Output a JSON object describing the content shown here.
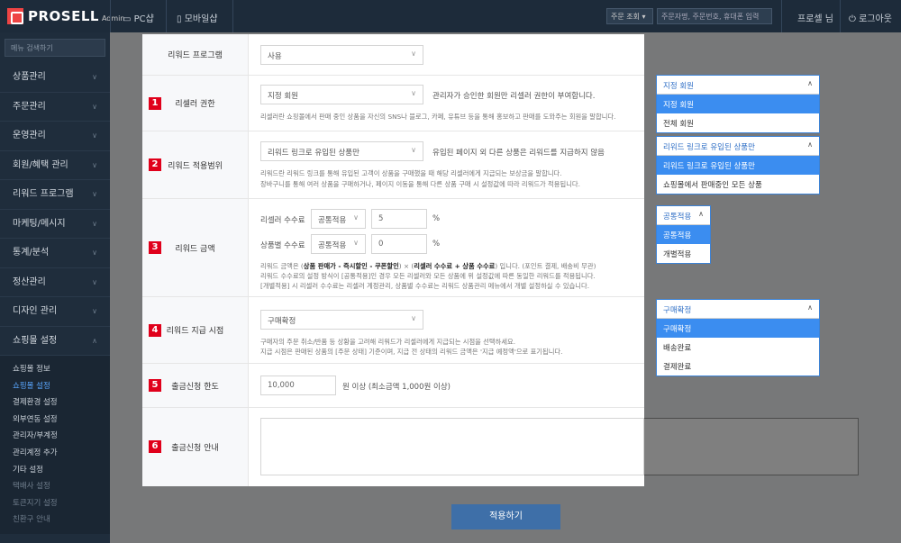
{
  "topbar": {
    "logo_text": "PROSELL",
    "logo_sub": "Admin",
    "pc_label": "PC샵",
    "mobile_label": "모바일샵",
    "order_select": "주문 조회",
    "search_placeholder": "주문자명, 주문번호, 휴대폰 입력",
    "profile": "프로셀 님",
    "logout": "로그아웃"
  },
  "sidebar": {
    "search_placeholder": "메뉴 검색하기",
    "items": [
      {
        "label": "상품관리"
      },
      {
        "label": "주문관리"
      },
      {
        "label": "운영관리"
      },
      {
        "label": "회원/혜택 관리"
      },
      {
        "label": "리워드 프로그램"
      },
      {
        "label": "마케팅/메시지"
      },
      {
        "label": "통계/분석"
      },
      {
        "label": "정산관리"
      },
      {
        "label": "디자인 관리"
      },
      {
        "label": "쇼핑몰 설정"
      }
    ],
    "sub_items": [
      {
        "label": "쇼핑몰 정보"
      },
      {
        "label": "쇼핑몰 설정"
      },
      {
        "label": "결제환경 설정"
      },
      {
        "label": "외부연동 설정"
      },
      {
        "label": "관리자/부계정"
      },
      {
        "label": "관리계정 추가"
      },
      {
        "label": "기타 설정"
      },
      {
        "label": "택배사 설정"
      },
      {
        "label": "토큰지기 설정"
      },
      {
        "label": "친환구 안내"
      }
    ]
  },
  "apply_button": "적용하기",
  "form": {
    "row0": {
      "label": "리워드 프로그램",
      "value": "사용"
    },
    "row1": {
      "num": "1",
      "label": "리셀러 권한",
      "value": "지정 회원",
      "note": "관리자가 승인한 회원만 리셀러 권한이 부여합니다.",
      "help": "리셀러란 쇼핑몰에서 판매 중인 상품을 자신의 SNS나 블로그, 카페, 유튜브 등을 통해 홍보하고 판매를 도와주는 회원을 말합니다."
    },
    "row2": {
      "num": "2",
      "label": "리워드 적용범위",
      "value": "리워드 링크로 유입된 상품만",
      "note": "유입된 페이지 외 다른 상품은 리워드를 지급하지 않음",
      "help1": "리워드란 리워드 링크를 통해 유입된 고객이 상품을 구매했을 때 해당 리셀러에게 지급되는 보상금을 말합니다.",
      "help2": "장바구니를 통해 여러 상품을 구매하거나, 페이지 이동을 통해 다른 상품 구매 시 설정값에 따라 리워드가 적용됩니다."
    },
    "row3": {
      "num": "3",
      "label": "리워드 금액",
      "reseller_fee_label": "리셀러 수수료",
      "reseller_fee_mode": "공통적용",
      "reseller_fee_value": "5",
      "product_fee_label": "상품별 수수료",
      "product_fee_mode": "공통적용",
      "product_fee_value": "0",
      "percent": "%",
      "help1_a": "리워드 금액은 (",
      "help1_b": "상품 판매가 - 즉시할인 - 쿠폰할인",
      "help1_c": ") × (",
      "help1_d": "리셀러 수수료 + 상품 수수료",
      "help1_e": ") 입니다. (포인트 결제, 배송비 무관)",
      "help2": "리워드 수수료의 설정 방식이 [공통적용]인 경우 모든 리셀러와 모든 상품에 위 설정값에 따른 동일한 리워드를 적용됩니다.",
      "help3": "[개별적용] 시 리셀러 수수료는 리셀러 계정관리, 상품별 수수료는 리워드 상품관리 메뉴에서 개별 설정하실 수 있습니다."
    },
    "row4": {
      "num": "4",
      "label": "리워드 지급 시점",
      "value": "구매확정",
      "help1": "구매자의 주문 취소/반품 등 상황을 고려해 리워드가 리셀러에게 지급되는 시점을 선택하세요.",
      "help2": "지급 시점은 판매된 상품의 [주문 상태] 기준이며, 지급 전 상태의 리워드 금액은 '지급 예정액'으로 표기됩니다."
    },
    "row5": {
      "num": "5",
      "label": "출금신청 한도",
      "value": "10,000",
      "unit": "원 이상 (최소금액 1,000원 이상)"
    },
    "row6": {
      "num": "6",
      "label": "출금신청 안내"
    }
  },
  "dropdowns": {
    "d1": {
      "head": "지정 회원",
      "options": [
        "지정 회원",
        "전체 회원"
      ],
      "selected": 0
    },
    "d2": {
      "head": "리워드 링크로 유입된 상품만",
      "options": [
        "리워드 링크로 유입된 상품만",
        "쇼핑몰에서 판매중인 모든 상품"
      ],
      "selected": 0
    },
    "d3": {
      "head": "공통적용",
      "options": [
        "공통적용",
        "개별적용"
      ],
      "selected": 0
    },
    "d4": {
      "head": "구매확정",
      "options": [
        "구매확정",
        "배송완료",
        "결제완료"
      ],
      "selected": 0
    }
  },
  "colors": {
    "badge": "#e0001b",
    "accent": "#3b8df0",
    "sidebar": "#1f2d3c"
  }
}
